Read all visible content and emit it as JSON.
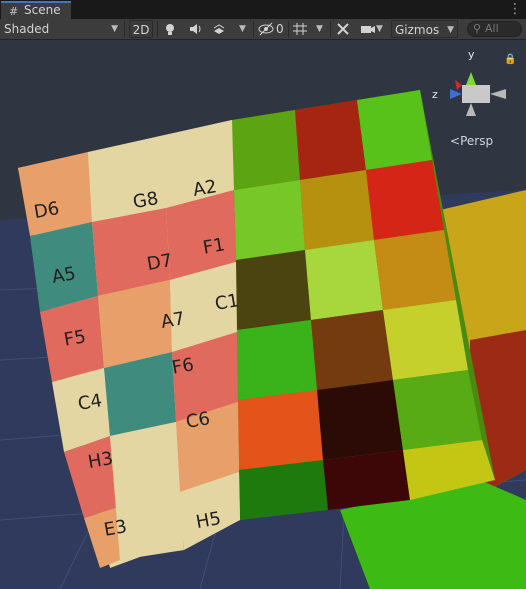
{
  "tab": {
    "title": "Scene",
    "icon": "scene-grid-icon",
    "menu_icon": "kebab-menu-icon"
  },
  "toolbar": {
    "shading_mode": "Shaded",
    "mode_2d": "2D",
    "hidden_count": "0",
    "gizmos": "Gizmos",
    "search_placeholder": "All",
    "icons": [
      "lighting-icon",
      "audio-icon",
      "effects-icon",
      "hidden-objects-icon",
      "grid-icon",
      "tools-icon",
      "camera-icon",
      "search-icon"
    ]
  },
  "viewport": {
    "projection_label": "Persp",
    "axis_labels": {
      "y": "y",
      "z": "z"
    },
    "cube_labels": [
      [
        "D6",
        "G8",
        "A2"
      ],
      [
        "A5",
        "D7",
        "F1"
      ],
      [
        "F5",
        "A7",
        "C1"
      ],
      [
        "C4",
        "F6",
        ""
      ],
      [
        "H3",
        "C6",
        ""
      ],
      [
        "E3",
        "H5",
        ""
      ]
    ],
    "colors": {
      "sky": "#2f3642",
      "ground": "#303a5c",
      "red": "#e06a5e",
      "cream": "#e4d6a3",
      "teal": "#3f8c7f",
      "orange": "#e8a06a"
    }
  }
}
